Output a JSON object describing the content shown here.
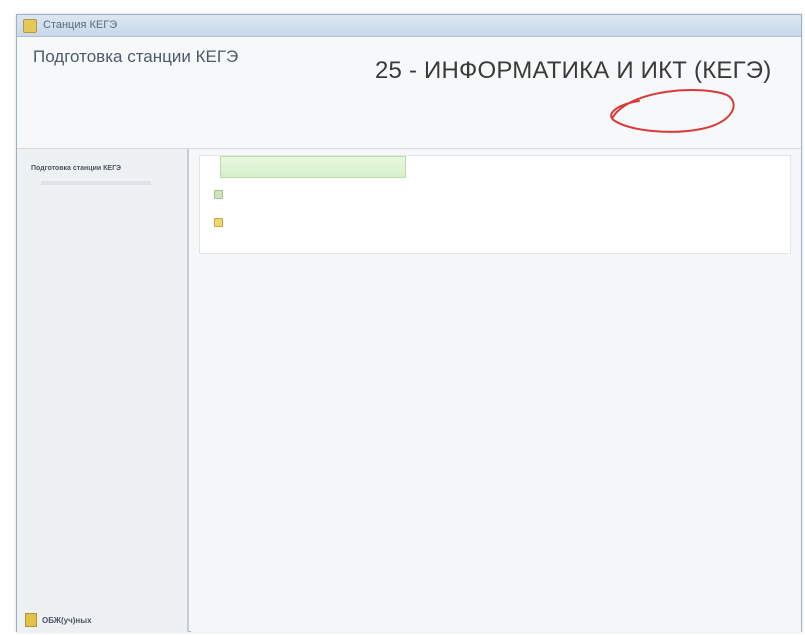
{
  "window": {
    "title": "Станция КЕГЭ"
  },
  "header": {
    "app_title": "Подготовка станции КЕГЭ",
    "app_description": "",
    "exam_title": "25 - ИНФОРМАТИКА И ИКТ (КЕГЭ)",
    "info_line1": "",
    "info_line2": "",
    "annotation_color": "#d83a3a"
  },
  "sidebar": {
    "title": "Подготовка станции КЕГЭ",
    "stats": [],
    "status_text": "",
    "links": [],
    "footer_label": "ОБЖ(уч)ных"
  },
  "main": {
    "start_button_label": "",
    "messages": [
      {
        "icon": "info-icon",
        "text": ""
      },
      {
        "icon": "warning-icon",
        "text": ""
      }
    ]
  },
  "colors": {
    "accent_green": "#d6f0c8",
    "annotation_red": "#d83a3a"
  }
}
